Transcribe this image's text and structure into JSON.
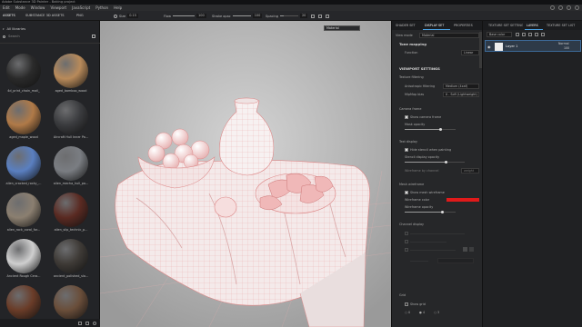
{
  "app": {
    "title": "Adobe Substance 3D Painter - Baking project"
  },
  "menu": [
    "Edit",
    "Mode",
    "Window",
    "Viewport",
    "JavaScript",
    "Python",
    "Help"
  ],
  "toolbar": {
    "tabs": [
      "ASSETS",
      "SUBSTANCE 3D ASSETS",
      "PNG"
    ],
    "size_label": "Size",
    "size_value": "0.15",
    "flow_label": "Flow",
    "flow_value": "100",
    "stroke_label": "Stroke opac",
    "stroke_value": "100",
    "spacing_label": "Spacing",
    "spacing_value": "20"
  },
  "assets": {
    "filter_label": "All libraries",
    "search_placeholder": "Search",
    "items": [
      {
        "label": "4d_print_chain_mail_",
        "color": "#2a2a2a"
      },
      {
        "label": "aged_bamboo_wood",
        "color": "#b88a5a"
      },
      {
        "label": "aged_maple_wood",
        "color": "#b07a48"
      },
      {
        "label": "Aircraft Hull Inner Pa...",
        "color": "#3a3b3e"
      },
      {
        "label": "alien_cracked_rocky_...",
        "color": "#5a7fc0"
      },
      {
        "label": "alien_mecha_hull_pa...",
        "color": "#7a7d82"
      },
      {
        "label": "alien_rock_coral_for...",
        "color": "#8b7f70"
      },
      {
        "label": "alien_slip_technic_p...",
        "color": "#5a2a22"
      },
      {
        "label": "Ancient Rough Cera...",
        "color": "#cfcfcf"
      },
      {
        "label": "ancient_polished_sla...",
        "color": "#3e3a36"
      },
      {
        "label": "",
        "color": "#6a3c28"
      },
      {
        "label": "",
        "color": "#6a4e3a"
      }
    ]
  },
  "viewport": {
    "dropdown": "Material"
  },
  "right_tabs": [
    "SHADER SET",
    "DISPLAY SET",
    "PROPERTIES"
  ],
  "display_settings": {
    "view_mode_label": "View mode",
    "view_mode_value": "Material",
    "tone_mapping": "Tone mapping",
    "function_label": "Function",
    "function_value": "Linear",
    "viewport_settings": "VIEWPORT SETTINGS",
    "texture_filtering": "Texture filtering",
    "anisotropic_label": "Anisotropic filtering",
    "anisotropic_value": "Medium (4xaf)",
    "mipmap_label": "MipMap bias",
    "mipmap_value": "0 - Soft (Lightweight)",
    "camera_frame": "Camera frame",
    "show_camera_frame": "Show camera frame",
    "mask_opacity": "Mask opacity",
    "text_display": "Text display",
    "hide_stencil": "Hide stencil when painting",
    "stencil_opacity": "Stencil display opacity",
    "wireframe_toggle": "Wireframe by channel",
    "weight_btn": "weight",
    "mesh_wireframe": "Mesh wireframe",
    "show_mesh_wireframe": "Show mesh wireframe",
    "wireframe_color": "Wireframe color",
    "wireframe_color_hex": "#e01a1a",
    "wireframe_opacity": "Wireframe opacity",
    "channel_display": "Channel display",
    "grid": "Grid",
    "show_grid": "Show grid",
    "grid_options": [
      "0",
      "4",
      "3"
    ]
  },
  "layers": {
    "tabs": [
      "TEXTURE SET SETTINGS",
      "LAYERS",
      "TEXTURE SET LIST"
    ],
    "base_color_label": "Base color",
    "layer_name": "Layer 1",
    "blend_mode": "Normal",
    "opacity": "100"
  }
}
